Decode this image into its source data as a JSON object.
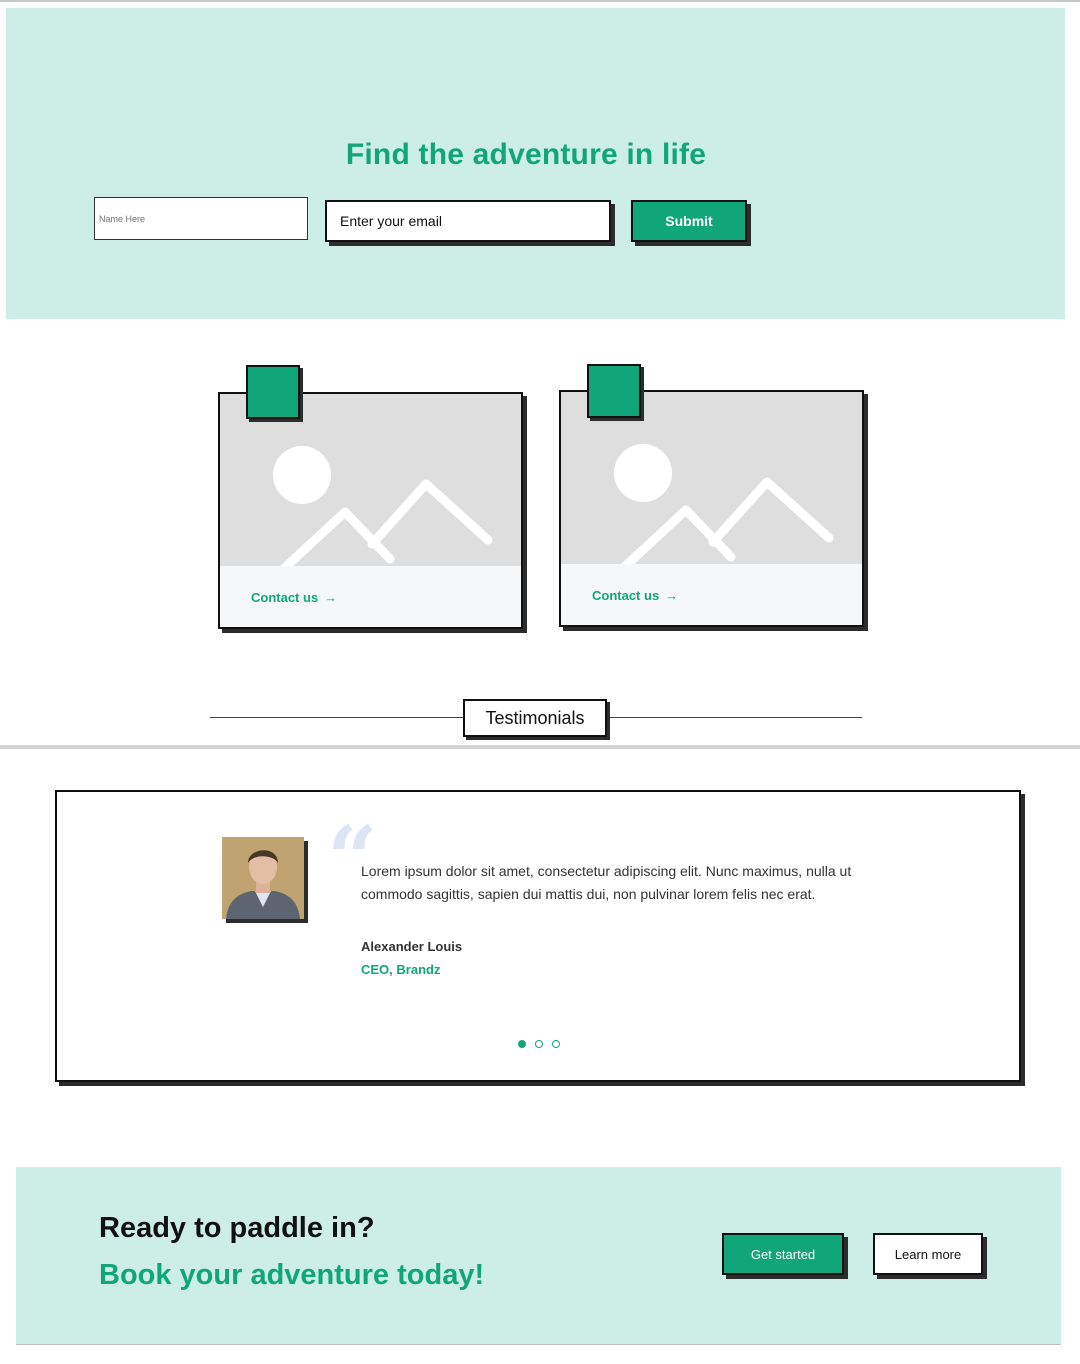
{
  "hero": {
    "title": "Find the adventure in life",
    "name_placeholder": "Name Here",
    "email_placeholder": "Enter your email",
    "submit_label": "Submit"
  },
  "cards": [
    {
      "link_label": "Contact us",
      "arrow": "→",
      "image_icon": "image-placeholder-icon"
    },
    {
      "link_label": "Contact us",
      "arrow": "→",
      "image_icon": "image-placeholder-icon"
    }
  ],
  "testimonials": {
    "heading": "Testimonials",
    "quote_icon": "quote-icon",
    "quote": "Lorem ipsum dolor sit amet, consectetur adipiscing elit. Nunc maximus, nulla ut commodo sagittis, sapien dui mattis dui, non pulvinar lorem felis nec erat.",
    "author_name": "Alexander Louis",
    "author_title": "CEO, Brandz",
    "slide_count": 3,
    "active_slide": 1
  },
  "cta": {
    "title": "Ready to paddle in?",
    "subtitle": "Book your adventure today!",
    "primary_label": "Get started",
    "secondary_label": "Learn more"
  },
  "colors": {
    "accent": "#11a57a",
    "hero_bg": "#cdeee6",
    "border": "#111111",
    "shadow": "#2c2c2c"
  }
}
